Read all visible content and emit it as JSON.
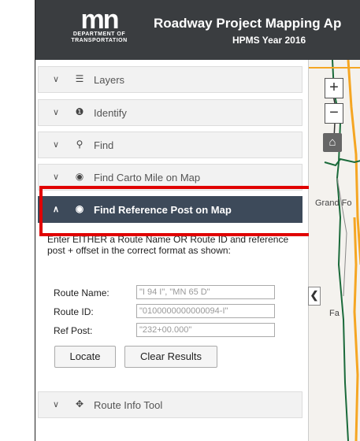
{
  "header": {
    "logo_mark": "mn",
    "logo_line1": "DEPARTMENT OF",
    "logo_line2": "TRANSPORTATION",
    "title": "Roadway Project Mapping Ap",
    "subtitle": "HPMS Year 2016",
    "background": "#3a3d40"
  },
  "sidebar": {
    "panels": [
      {
        "label": "Layers",
        "icon": "list-icon",
        "chevron": "chevron-down-icon"
      },
      {
        "label": "Identify",
        "icon": "info-icon",
        "chevron": "chevron-down-icon"
      },
      {
        "label": "Find",
        "icon": "search-icon",
        "chevron": "chevron-down-icon"
      },
      {
        "label": "Find Carto Mile on Map",
        "icon": "target-icon",
        "chevron": "chevron-down-icon"
      },
      {
        "label": "Find Reference Post on Map",
        "icon": "target-icon",
        "chevron": "chevron-up-icon",
        "active": true
      },
      {
        "label": "Route Info Tool",
        "icon": "move-icon",
        "chevron": "chevron-down-icon"
      }
    ],
    "active_color": "#3d4a5a",
    "highlight_color": "#e00000"
  },
  "ref_post_form": {
    "instructions": "Enter EITHER a Route Name OR Route ID and reference post + offset in the correct format as shown:",
    "route_name_label": "Route Name:",
    "route_name_placeholder": "\"I 94 I\", \"MN 65 D\"",
    "route_id_label": "Route ID:",
    "route_id_placeholder": "\"0100000000000094-I\"",
    "ref_post_label": "Ref Post:",
    "ref_post_placeholder": "\"232+00.000\"",
    "locate_label": "Locate",
    "clear_label": "Clear Results"
  },
  "map": {
    "zoom_in": "+",
    "zoom_out": "−",
    "home_icon": "home-icon",
    "labels": [
      "Grand Fo",
      "Fa"
    ],
    "collapse_icon": "chevron-left-icon"
  }
}
